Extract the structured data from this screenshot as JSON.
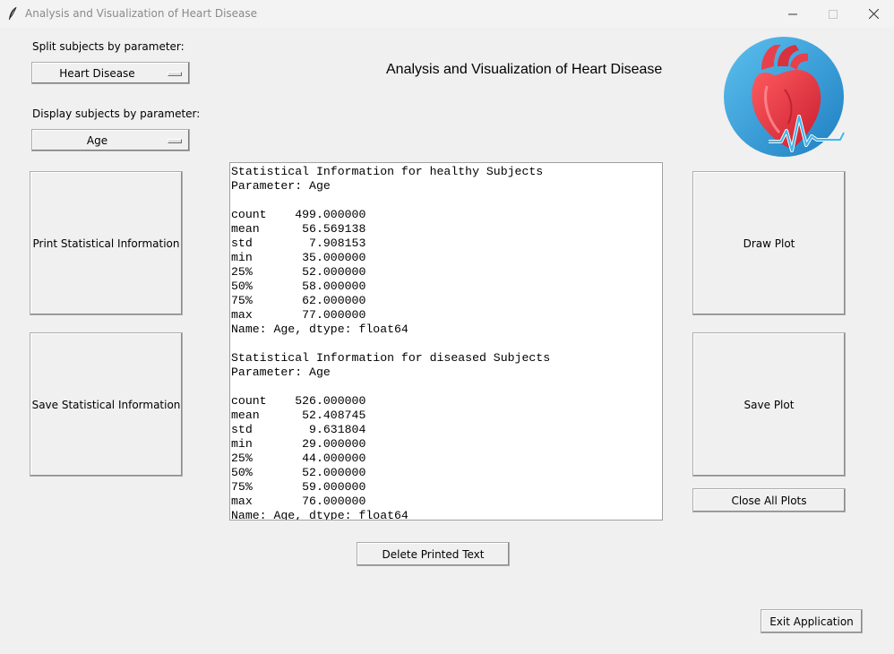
{
  "window": {
    "title": "Analysis and Visualization of Heart Disease",
    "controls": [
      "minimize",
      "maximize",
      "close"
    ]
  },
  "left_panel": {
    "split_label": "Split subjects by parameter:",
    "split_value": "Heart Disease",
    "display_label": "Display subjects by parameter:",
    "display_value": "Age",
    "print_button": "Print Statistical Information",
    "save_button": "Save Statistical Information"
  },
  "header": {
    "title": "Analysis and Visualization of Heart Disease"
  },
  "logo": {
    "icon": "heart-ecg-logo",
    "colors": {
      "circle": "#3a9fd8",
      "heart": "#e8313f",
      "pulse": "#5bc3f0"
    }
  },
  "output": {
    "text": "Statistical Information for healthy Subjects\nParameter: Age\n\ncount    499.000000\nmean      56.569138\nstd        7.908153\nmin       35.000000\n25%       52.000000\n50%       58.000000\n75%       62.000000\nmax       77.000000\nName: Age, dtype: float64\n\nStatistical Information for diseased Subjects\nParameter: Age\n\ncount    526.000000\nmean      52.408745\nstd        9.631804\nmin       29.000000\n25%       44.000000\n50%       52.000000\n75%       59.000000\nmax       76.000000\nName: Age, dtype: float64"
  },
  "right_panel": {
    "draw_button": "Draw Plot",
    "save_plot_button": "Save Plot",
    "close_plots_button": "Close All Plots"
  },
  "bottom": {
    "delete_button": "Delete Printed Text",
    "exit_button": "Exit Application"
  }
}
